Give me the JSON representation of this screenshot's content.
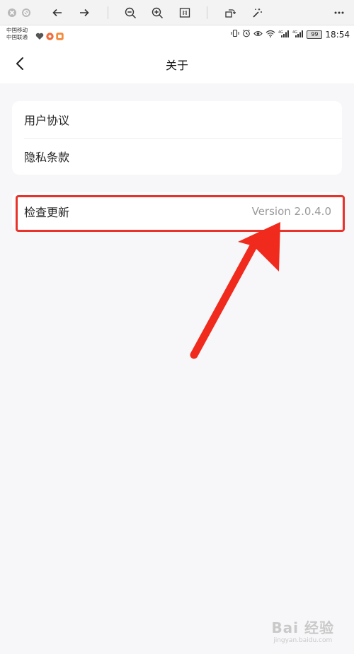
{
  "status": {
    "carrier_line1": "中国移动",
    "carrier_line2": "中国联通",
    "battery": "99",
    "time": "18:54"
  },
  "header": {
    "back_icon": "chevron-left-icon",
    "title": "关于"
  },
  "settings": {
    "items": [
      {
        "label": "用户协议"
      },
      {
        "label": "隐私条款"
      }
    ],
    "update": {
      "label": "检查更新",
      "version": "Version 2.0.4.0"
    }
  },
  "annotation": {
    "highlight_color": "#e8322b",
    "arrow_color": "#f02a1d"
  },
  "watermark": {
    "brand": "Bai 经验",
    "url": "jingyan.baidu.com"
  }
}
